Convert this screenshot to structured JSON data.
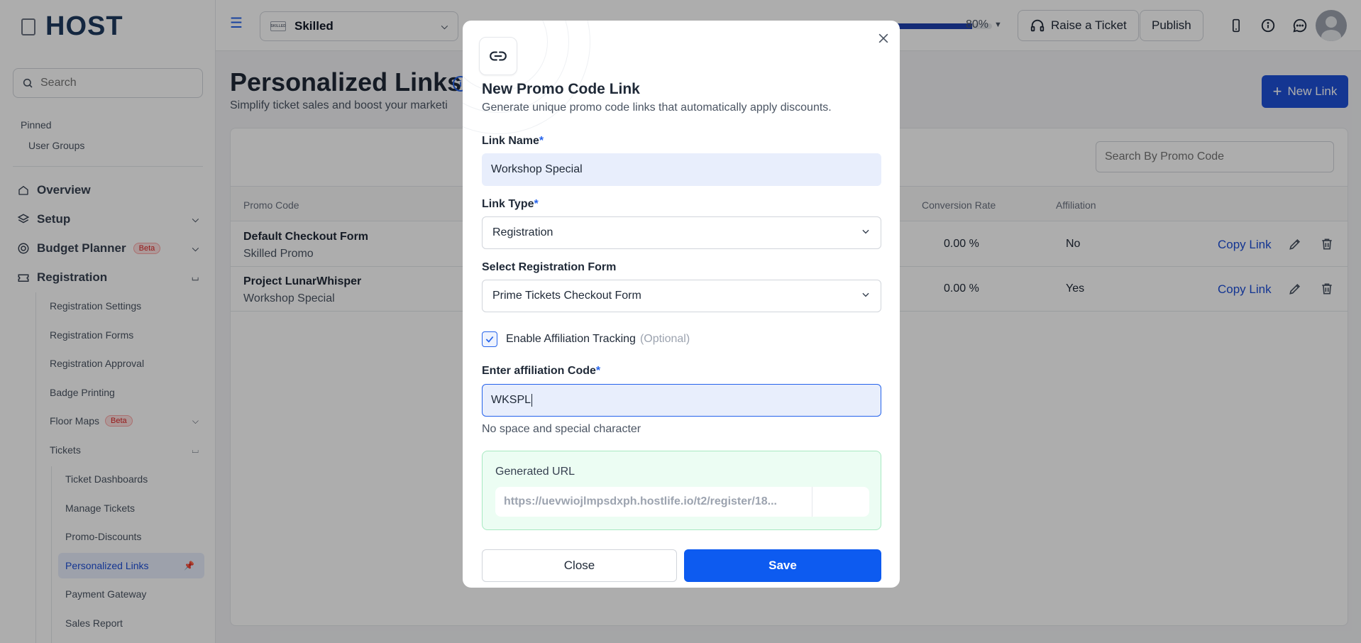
{
  "brand": {
    "logo_text": "HOST"
  },
  "sidebar": {
    "search_placeholder": "Search",
    "pinned_label": "Pinned",
    "pinned_items": [
      "User Groups"
    ],
    "nav": {
      "overview": "Overview",
      "setup": "Setup",
      "budget_planner": "Budget Planner",
      "registration": "Registration",
      "beta": "Beta"
    },
    "registration_items": [
      "Registration Settings",
      "Registration Forms",
      "Registration Approval",
      "Badge Printing",
      "Floor Maps",
      "Tickets"
    ],
    "ticket_items": [
      "Ticket Dashboards",
      "Manage Tickets",
      "Promo-Discounts",
      "Personalized Links",
      "Payment Gateway",
      "Sales Report"
    ]
  },
  "topbar": {
    "event_name": "Skilled",
    "event_thumb": "SKILLED",
    "progress_pct": 80,
    "progress_label": "80%",
    "raise_ticket": "Raise a Ticket",
    "publish": "Publish"
  },
  "page": {
    "title": "Personalized Links",
    "subtitle": "Simplify ticket sales and boost your marketi",
    "new_link": "New Link",
    "search_placeholder": "Search By Promo Code",
    "columns": [
      "Promo Code",
      "Conversion Rate",
      "Affiliation"
    ],
    "rows": [
      {
        "title": "Default Checkout Form",
        "sub": "Skilled Promo",
        "conversion": "0.00 %",
        "affiliation": "No",
        "action": "Copy Link"
      },
      {
        "title": "Project LunarWhisper",
        "sub": "Workshop Special",
        "conversion": "0.00 %",
        "affiliation": "Yes",
        "action": "Copy Link"
      }
    ]
  },
  "modal": {
    "title": "New Promo Code Link",
    "subtitle": "Generate unique promo code links that automatically apply discounts.",
    "link_name_label": "Link Name",
    "link_name_value": "Workshop Special",
    "link_type_label": "Link Type",
    "link_type_value": "Registration",
    "reg_form_label": "Select Registration Form",
    "reg_form_value": "Prime Tickets Checkout Form",
    "affiliation_label": "Enable Affiliation Tracking",
    "affiliation_optional": "(Optional)",
    "affiliation_checked": true,
    "aff_code_label": "Enter affiliation Code",
    "aff_code_value": "WKSPL",
    "hint": "No space and special character",
    "generated_url_label": "Generated URL",
    "generated_url": "https://uevwiojlmpsdxph.hostlife.io/t2/register/18...",
    "required_mark": "*",
    "close": "Close",
    "save": "Save"
  },
  "colors": {
    "primary": "#0d5bf0",
    "accent_blue": "#1e50d8",
    "success_bg": "#ecfdf3",
    "beta_red": "#dc2626"
  }
}
